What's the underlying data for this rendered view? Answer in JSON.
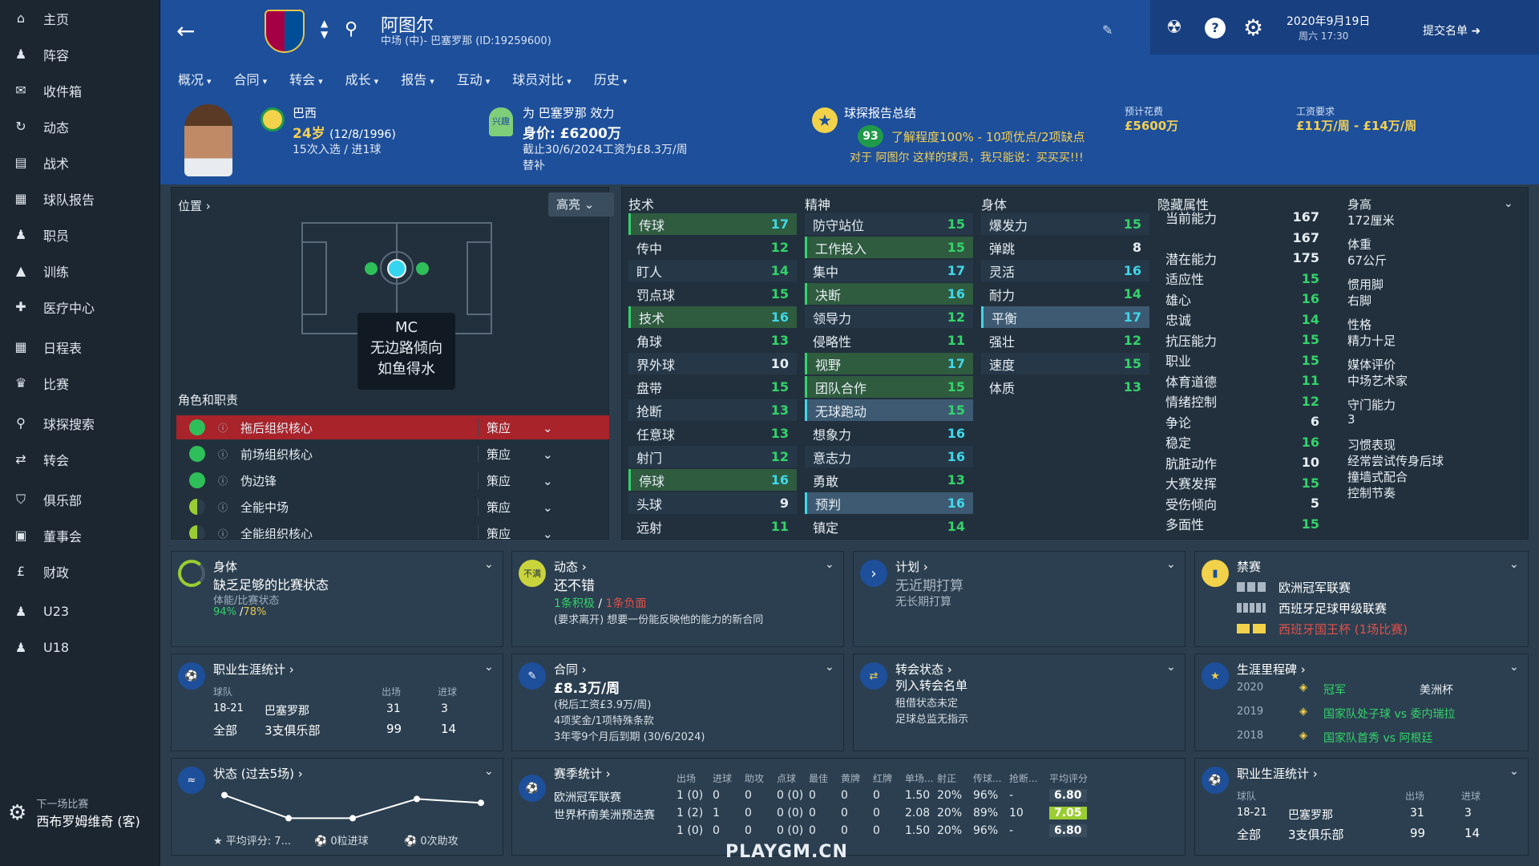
{
  "sidebar": {
    "items": [
      {
        "label": "主页",
        "icon": "home-icon"
      },
      {
        "label": "阵容",
        "icon": "squad-icon"
      },
      {
        "label": "收件箱",
        "icon": "inbox-icon"
      },
      {
        "label": "动态",
        "icon": "dynamics-icon"
      },
      {
        "label": "战术",
        "icon": "tactics-icon"
      },
      {
        "label": "球队报告",
        "icon": "report-icon"
      },
      {
        "label": "职员",
        "icon": "staff-icon"
      },
      {
        "label": "训练",
        "icon": "training-icon"
      },
      {
        "label": "医疗中心",
        "icon": "medical-icon"
      },
      {
        "label": "日程表",
        "icon": "calendar-icon"
      },
      {
        "label": "比赛",
        "icon": "trophy-icon"
      },
      {
        "label": "球探搜索",
        "icon": "search-icon"
      },
      {
        "label": "转会",
        "icon": "transfer-icon"
      },
      {
        "label": "俱乐部",
        "icon": "shield-icon"
      },
      {
        "label": "董事会",
        "icon": "board-icon"
      },
      {
        "label": "财政",
        "icon": "finance-icon"
      },
      {
        "label": "U23",
        "icon": "u23-icon"
      },
      {
        "label": "U18",
        "icon": "u18-icon"
      }
    ],
    "next_label": "下一场比赛",
    "next_value": "西布罗姆维奇 (客)"
  },
  "header": {
    "player_name": "阿图尔",
    "subtitle": "中场 (中)- 巴塞罗那 (ID:19259600)",
    "date": "2020年9月19日",
    "time": "周六 17:30",
    "submit": "提交名单",
    "tabs": [
      "概况",
      "合同",
      "转会",
      "成长",
      "报告",
      "互动",
      "球员对比",
      "历史"
    ]
  },
  "info": {
    "nation": "巴西",
    "age": "24岁",
    "birth": "(12/8/1996)",
    "caps": "15次入选 / 进1球",
    "club": "为 巴塞罗那 效力",
    "value": "身价: £6200万",
    "contract": "截止30/6/2024工资为£8.3万/周",
    "role": "替补",
    "interest": "兴趣",
    "scout_title": "球探报告总结",
    "scout_score": "93",
    "scout_summary": "了解程度100% - 10项优点/2项缺点",
    "scout_comment": "对于 阿图尔 这样的球员，我只能说：买买买!!!",
    "fee_label": "预计花费",
    "fee": "£5600万",
    "wage_label": "工资要求",
    "wage": "£11万/周 - £14万/周"
  },
  "pitch": {
    "label": "位置",
    "highlight": "高亮",
    "pos": "MC",
    "line1": "无边路倾向",
    "line2": "如鱼得水",
    "roles_title": "角色和职责",
    "roles": [
      {
        "name": "拖后组织核心",
        "duty": "策应"
      },
      {
        "name": "前场组织核心",
        "duty": "策应"
      },
      {
        "name": "伪边锋",
        "duty": "策应"
      },
      {
        "name": "全能中场",
        "duty": "策应"
      },
      {
        "name": "全能组织核心",
        "duty": "策应"
      }
    ]
  },
  "attrs": {
    "tech_title": "技术",
    "mental_title": "精神",
    "phys_title": "身体",
    "hidden_title": "隐藏属性",
    "technical": [
      [
        "传球",
        "17"
      ],
      [
        "传中",
        "12"
      ],
      [
        "盯人",
        "14"
      ],
      [
        "罚点球",
        "15"
      ],
      [
        "技术",
        "16"
      ],
      [
        "角球",
        "13"
      ],
      [
        "界外球",
        "10"
      ],
      [
        "盘带",
        "15"
      ],
      [
        "抢断",
        "13"
      ],
      [
        "任意球",
        "13"
      ],
      [
        "射门",
        "12"
      ],
      [
        "停球",
        "16"
      ],
      [
        "头球",
        "9"
      ],
      [
        "远射",
        "11"
      ]
    ],
    "mental": [
      [
        "防守站位",
        "15"
      ],
      [
        "工作投入",
        "15"
      ],
      [
        "集中",
        "17"
      ],
      [
        "决断",
        "16"
      ],
      [
        "领导力",
        "12"
      ],
      [
        "侵略性",
        "11"
      ],
      [
        "视野",
        "17"
      ],
      [
        "团队合作",
        "15"
      ],
      [
        "无球跑动",
        "15"
      ],
      [
        "想象力",
        "16"
      ],
      [
        "意志力",
        "16"
      ],
      [
        "勇敢",
        "13"
      ],
      [
        "预判",
        "16"
      ],
      [
        "镇定",
        "14"
      ]
    ],
    "physical": [
      [
        "爆发力",
        "15"
      ],
      [
        "弹跳",
        "8"
      ],
      [
        "灵活",
        "16"
      ],
      [
        "耐力",
        "14"
      ],
      [
        "平衡",
        "17"
      ],
      [
        "强壮",
        "12"
      ],
      [
        "速度",
        "15"
      ],
      [
        "体质",
        "13"
      ]
    ],
    "hidden": [
      [
        "当前能力",
        "167"
      ],
      [
        "",
        "167"
      ],
      [
        "潜在能力",
        "175"
      ],
      [
        "适应性",
        "15"
      ],
      [
        "雄心",
        "16"
      ],
      [
        "忠诚",
        "14"
      ],
      [
        "抗压能力",
        "15"
      ],
      [
        "职业",
        "15"
      ],
      [
        "体育道德",
        "11"
      ],
      [
        "情绪控制",
        "12"
      ],
      [
        "争论",
        "6"
      ],
      [
        "稳定",
        "16"
      ],
      [
        "肮脏动作",
        "10"
      ],
      [
        "大赛发挥",
        "15"
      ],
      [
        "受伤倾向",
        "5"
      ],
      [
        "多面性",
        "15"
      ]
    ],
    "info_list": [
      [
        "身高",
        "172厘米"
      ],
      [
        "体重",
        "67公斤"
      ],
      [
        "惯用脚",
        "右脚"
      ],
      [
        "性格",
        "精力十足"
      ],
      [
        "媒体评价",
        "中场艺术家"
      ],
      [
        "守门能力",
        "3"
      ]
    ],
    "habits_title": "习惯表现",
    "habits": [
      "经常尝试传身后球",
      "撞墙式配合",
      "控制节奏"
    ]
  },
  "cards": {
    "fitness": {
      "title": "身体",
      "status": "缺乏足够的比赛状态",
      "sub": "体能/比赛状态",
      "p1": "94%",
      "p2": "78%"
    },
    "dynamics": {
      "title": "动态",
      "status": "还不错",
      "badge": "不满",
      "pos": "1条积极",
      "neg": "1条负面",
      "note": "(要求离开) 想要一份能反映他的能力的新合同"
    },
    "plans": {
      "title": "计划",
      "l1": "无近期打算",
      "l2": "无长期打算"
    },
    "bans": {
      "title": "禁赛",
      "items": [
        "欧洲冠军联赛",
        "西班牙足球甲级联赛",
        "西班牙国王杯 (1场比赛)"
      ]
    },
    "career": {
      "title": "职业生涯统计",
      "h_team": "球队",
      "h_apps": "出场",
      "h_goals": "进球",
      "row1": [
        "18-21",
        "巴塞罗那",
        "31",
        "3"
      ],
      "row2": [
        "全部",
        "3支俱乐部",
        "99",
        "14"
      ]
    },
    "contract": {
      "title": "合同",
      "wage": "£8.3万/周",
      "l1": "(税后工资£3.9万/周)",
      "l2": "4项奖金/1项特殊条款",
      "l3": "3年零9个月后到期 (30/6/2024)"
    },
    "transfer": {
      "title": "转会状态",
      "l1": "列入转会名单",
      "l2": "租借状态未定",
      "l3": "足球总监无指示"
    },
    "milestones": {
      "title": "生涯里程碑",
      "rows": [
        [
          "2020",
          "冠军",
          "美洲杯"
        ],
        [
          "2019",
          "国家队处子球 vs 委内瑞拉",
          ""
        ],
        [
          "2018",
          "国家队首秀 vs 阿根廷",
          ""
        ]
      ]
    },
    "form": {
      "title": "状态 (过去5场)",
      "avg": "平均评分: 7...",
      "goals": "0粒进球",
      "assists": "0次助攻",
      "values": [
        7.2,
        6.6,
        6.6,
        7.1,
        7.0
      ]
    },
    "season": {
      "title": "赛季统计",
      "headers": [
        "出场",
        "进球",
        "助攻",
        "点球",
        "最佳",
        "黄牌",
        "红牌",
        "单场...",
        "射正",
        "传球...",
        "抢断...",
        "平均评分"
      ],
      "rows": [
        [
          "欧洲冠军联赛",
          "1 (0)",
          "0",
          "0",
          "0 (0)",
          "0",
          "0",
          "0",
          "1.50",
          "20%",
          "96%",
          "-",
          "6.80"
        ],
        [
          "世界杯南美洲预选赛",
          "1 (2)",
          "1",
          "0",
          "0 (0)",
          "0",
          "0",
          "0",
          "2.08",
          "20%",
          "89%",
          "10",
          "7.05"
        ],
        [
          "",
          "1 (0)",
          "0",
          "0",
          "0 (0)",
          "0",
          "0",
          "0",
          "1.50",
          "20%",
          "96%",
          "-",
          "6.80"
        ]
      ]
    },
    "career2": {
      "title": "职业生涯统计"
    }
  },
  "watermark": "PLAYGM.CN"
}
